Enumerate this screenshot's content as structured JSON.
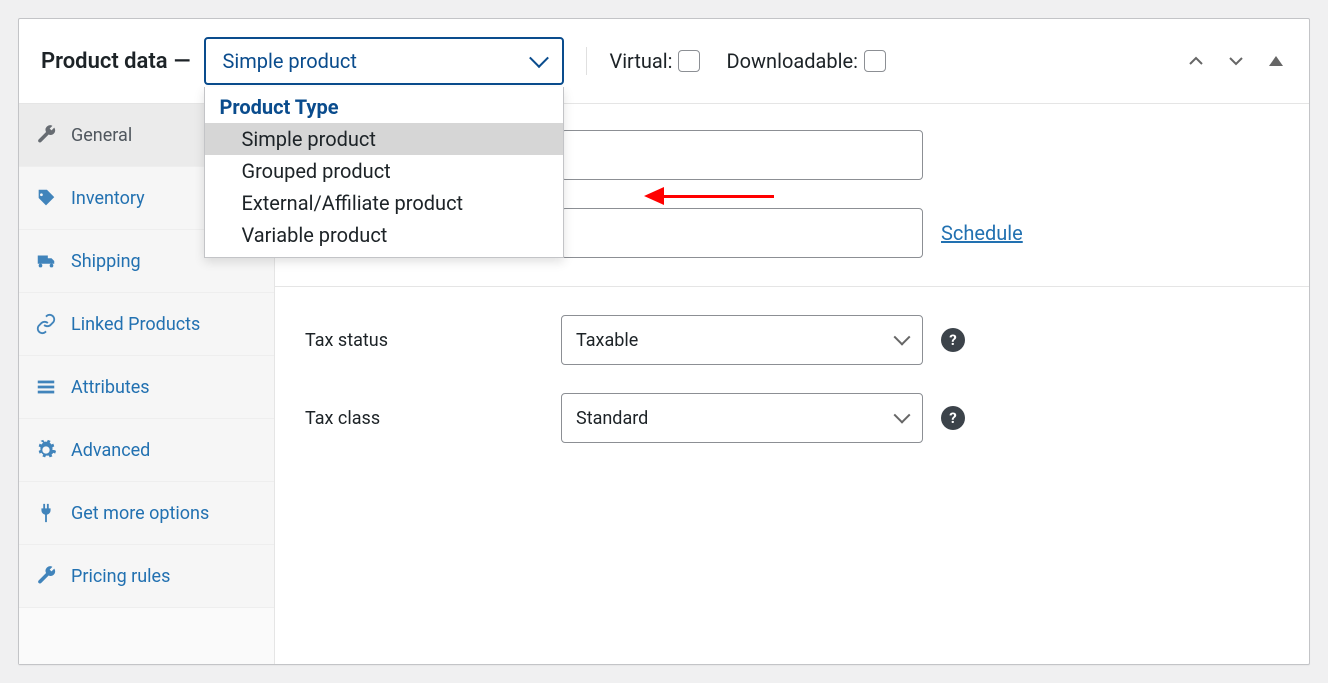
{
  "header": {
    "title": "Product data",
    "dash": "—",
    "selectedType": "Simple product",
    "optGroupLabel": "Product Type",
    "options": {
      "simple": "Simple product",
      "grouped": "Grouped product",
      "external": "External/Affiliate product",
      "variable": "Variable product"
    },
    "virtualLabel": "Virtual:",
    "downloadableLabel": "Downloadable:"
  },
  "tabs": {
    "general": "General",
    "inventory": "Inventory",
    "shipping": "Shipping",
    "linked": "Linked Products",
    "attributes": "Attributes",
    "advanced": "Advanced",
    "getmore": "Get more options",
    "pricing": "Pricing rules"
  },
  "fields": {
    "taxStatusLabel": "Tax status",
    "taxStatusValue": "Taxable",
    "taxClassLabel": "Tax class",
    "taxClassValue": "Standard",
    "scheduleLink": "Schedule",
    "helpGlyph": "?"
  }
}
